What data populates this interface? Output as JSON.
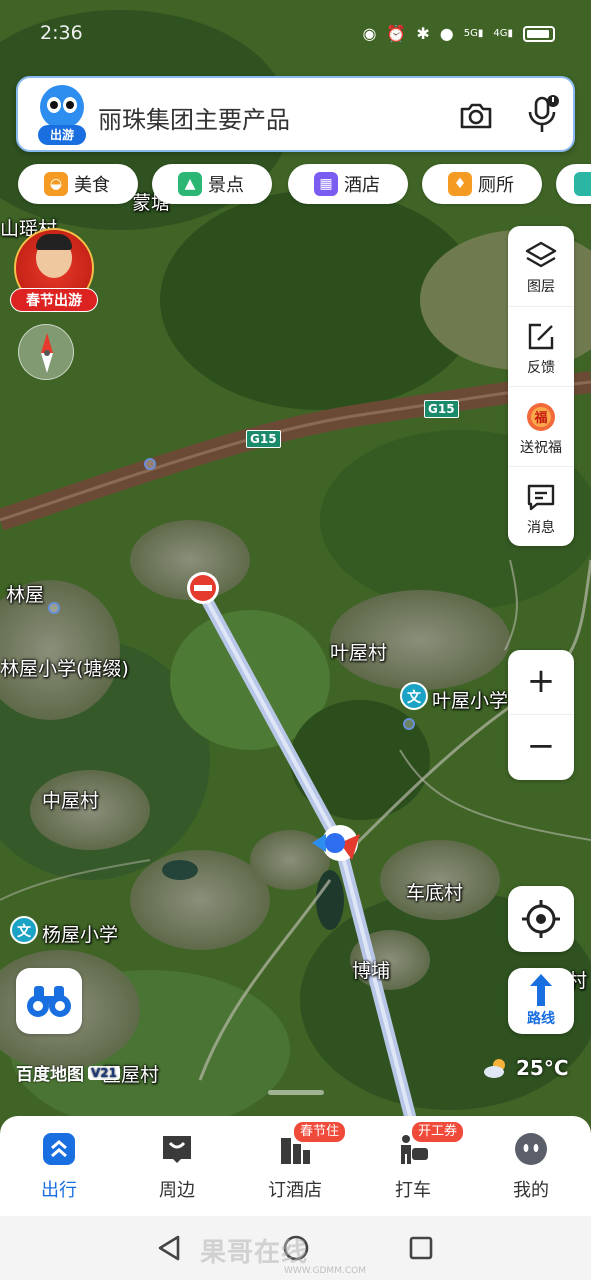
{
  "status_bar": {
    "time": "2:36",
    "network_labels": [
      "5G",
      "4G"
    ]
  },
  "search": {
    "avatar_tag": "出游",
    "query": "丽珠集团主要产品"
  },
  "chips": [
    {
      "label": "美食",
      "icon": "food-icon",
      "color": "#f59a23"
    },
    {
      "label": "景点",
      "icon": "scenic-icon",
      "color": "#2bb673"
    },
    {
      "label": "酒店",
      "icon": "hotel-icon",
      "color": "#7a5cf0"
    },
    {
      "label": "厕所",
      "icon": "toilet-icon",
      "color": "#f59a23"
    }
  ],
  "festival": {
    "label": "春节出游"
  },
  "tools": [
    {
      "label": "图层",
      "icon": "layers-icon"
    },
    {
      "label": "反馈",
      "icon": "feedback-icon"
    },
    {
      "label": "送祝福",
      "icon": "blessing-icon"
    },
    {
      "label": "消息",
      "icon": "message-icon"
    }
  ],
  "zoom": {
    "in": "+",
    "out": "−"
  },
  "route": {
    "label": "路线"
  },
  "map": {
    "highway_shields": [
      "G15",
      "G15"
    ],
    "places": [
      "山瑶村",
      "蒙塘",
      "林屋",
      "林屋小学(塘缀)",
      "叶屋村",
      "叶屋小学",
      "中屋村",
      "车底村",
      "杨屋小学",
      "博埔",
      "匠屋村",
      "村"
    ],
    "poi_icon_char": "文",
    "brand": "百度地图",
    "brand_version": "V21"
  },
  "weather": {
    "temp": "25°C",
    "icon": "partly-cloudy-icon"
  },
  "bottom_nav": [
    {
      "label": "出行",
      "icon": "travel-icon",
      "active": true,
      "badge": ""
    },
    {
      "label": "周边",
      "icon": "nearby-icon",
      "active": false,
      "badge": ""
    },
    {
      "label": "订酒店",
      "icon": "book-hotel-icon",
      "active": false,
      "badge": "春节住"
    },
    {
      "label": "打车",
      "icon": "taxi-icon",
      "active": false,
      "badge": "开工券"
    },
    {
      "label": "我的",
      "icon": "profile-icon",
      "active": false,
      "badge": ""
    }
  ],
  "watermark": {
    "text": "果哥在线",
    "url": "WWW.GDMM.COM"
  },
  "colors": {
    "accent": "#1a6fe0",
    "badge": "#f04a3a",
    "highway": "#1a8a6a"
  }
}
